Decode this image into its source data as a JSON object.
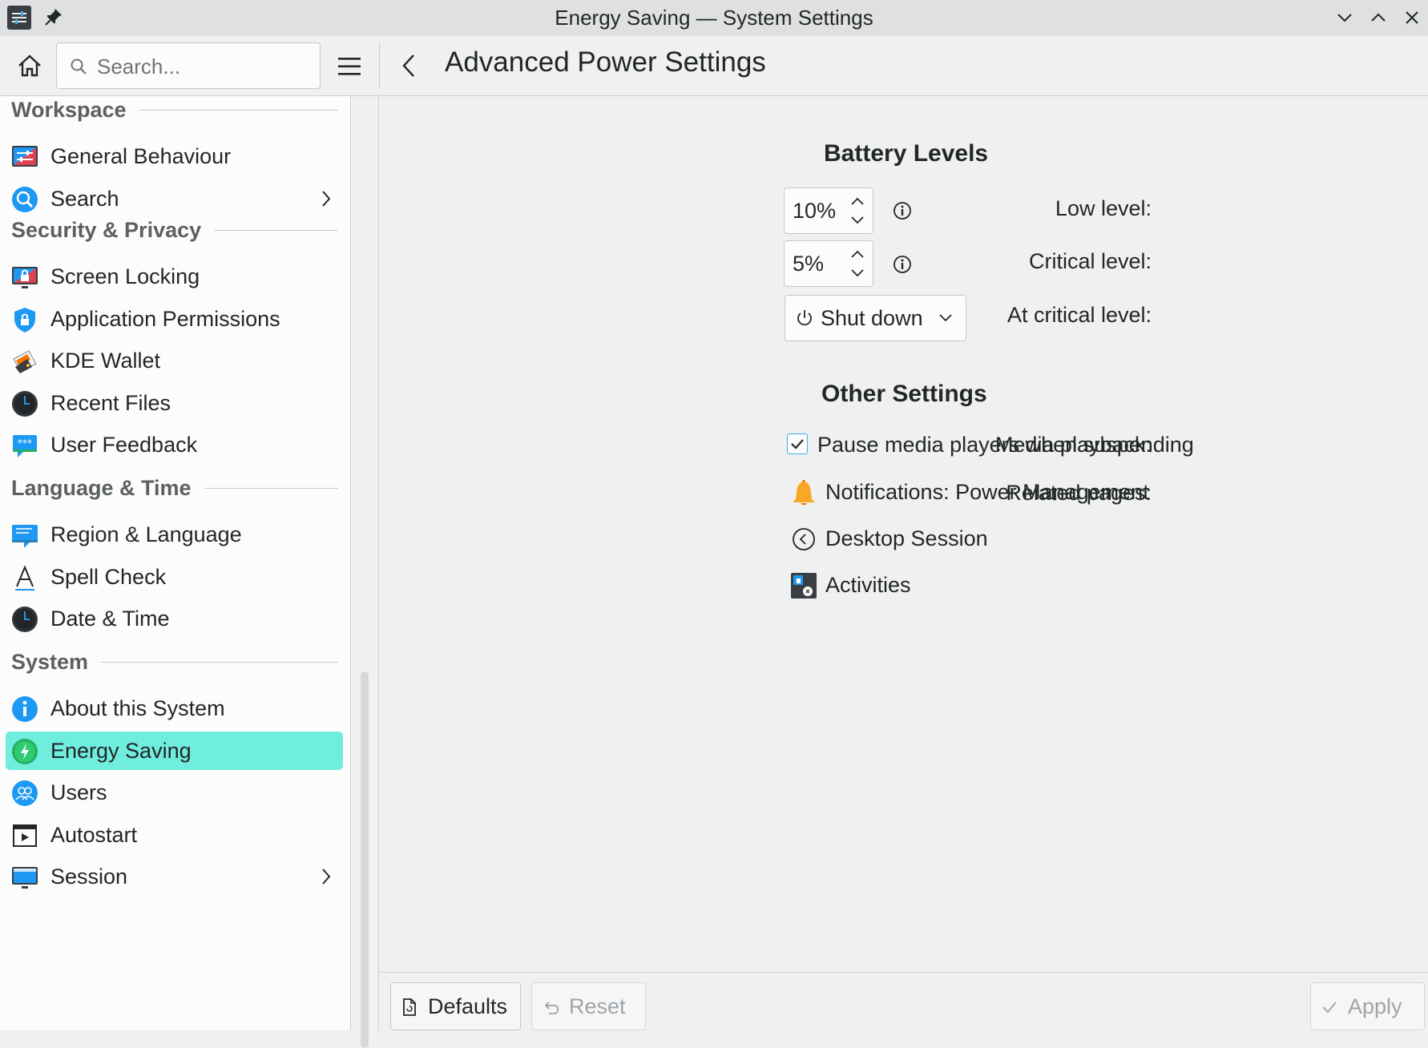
{
  "window": {
    "title": "Energy Saving — System Settings",
    "controls": [
      "minimize-icon",
      "maximize-icon",
      "close-icon"
    ]
  },
  "toolbar": {
    "search_placeholder": "Search...",
    "page_title": "Advanced Power Settings"
  },
  "sidebar": {
    "sections": [
      {
        "title": "Workspace",
        "items": [
          {
            "label": "General Behaviour",
            "icon": "general-behaviour-icon"
          },
          {
            "label": "Search",
            "icon": "search-icon",
            "has_submenu": true
          }
        ]
      },
      {
        "title": "Security & Privacy",
        "items": [
          {
            "label": "Screen Locking",
            "icon": "screen-locking-icon"
          },
          {
            "label": "Application Permissions",
            "icon": "shield-icon"
          },
          {
            "label": "KDE Wallet",
            "icon": "wallet-icon"
          },
          {
            "label": "Recent Files",
            "icon": "clock-icon"
          },
          {
            "label": "User Feedback",
            "icon": "feedback-icon"
          }
        ]
      },
      {
        "title": "Language & Time",
        "items": [
          {
            "label": "Region & Language",
            "icon": "region-icon"
          },
          {
            "label": "Spell Check",
            "icon": "spell-check-icon"
          },
          {
            "label": "Date & Time",
            "icon": "clock-icon"
          }
        ]
      },
      {
        "title": "System",
        "items": [
          {
            "label": "About this System",
            "icon": "info-icon"
          },
          {
            "label": "Energy Saving",
            "icon": "energy-icon",
            "selected": true
          },
          {
            "label": "Users",
            "icon": "users-icon"
          },
          {
            "label": "Autostart",
            "icon": "autostart-icon"
          },
          {
            "label": "Session",
            "icon": "session-icon",
            "has_submenu": true
          }
        ]
      }
    ]
  },
  "battery": {
    "heading": "Battery Levels",
    "low_label": "Low level:",
    "low_value": "10%",
    "critical_label": "Critical level:",
    "critical_value": "5%",
    "action_label": "At critical level:",
    "action_value": "Shut down"
  },
  "other": {
    "heading": "Other Settings",
    "media_label": "Media playback:",
    "media_checkbox_label": "Pause media players when suspending",
    "media_checked": true,
    "related_label": "Related pages:",
    "related_pages": [
      {
        "label": "Notifications: Power Management",
        "icon": "bell-icon"
      },
      {
        "label": "Desktop Session",
        "icon": "desktop-session-icon"
      },
      {
        "label": "Activities",
        "icon": "activities-icon"
      }
    ]
  },
  "footer": {
    "defaults_label": "Defaults",
    "reset_label": "Reset",
    "apply_label": "Apply"
  },
  "colors": {
    "selection": "#70eedd",
    "accent": "#3daee9"
  }
}
